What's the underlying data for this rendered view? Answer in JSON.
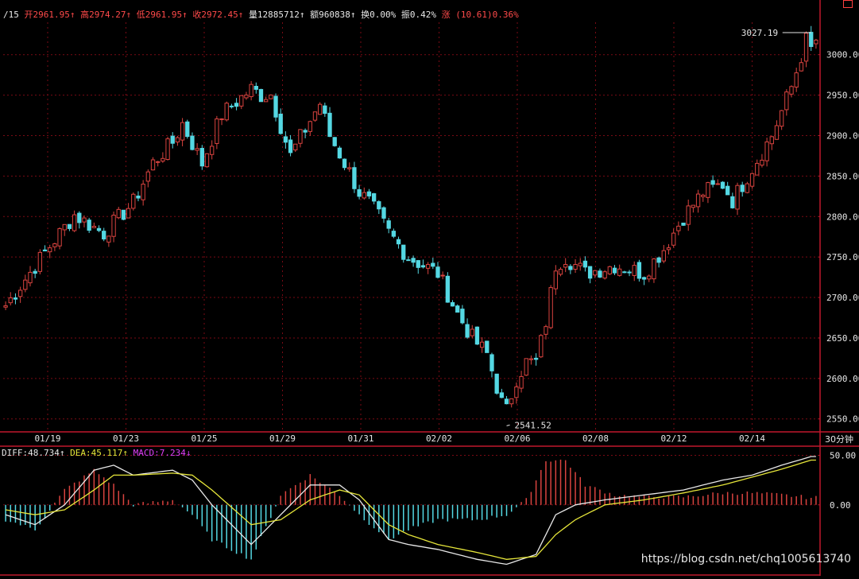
{
  "colors": {
    "up": "#d9433f",
    "down": "#54d8e3",
    "border": "#c0182c",
    "grid": "#7a0a14",
    "axis_text": "#e6e6e6",
    "diff": "#e8e8e8",
    "dea": "#e6e63a",
    "macd": "#e040fb",
    "header_red": "#ff4a4a"
  },
  "header": {
    "prefix": "/15",
    "open": "开2961.95↑",
    "high": "高2974.27↑",
    "low": "低2961.95↑",
    "close": "收2972.45↑",
    "volume": "量12885712↑",
    "amount": "额960838↑",
    "turnover": "换0.00%",
    "amplitude": "振0.42%",
    "change_label": "涨",
    "change_value": "(10.61)0.36%"
  },
  "macd_header": {
    "diff": "DIFF:48.734↑",
    "dea": "DEA:45.117↑",
    "macd": "MACD:7.234↓"
  },
  "period_label": "30分钟",
  "watermark": "https://blog.csdn.net/chq1005613740",
  "chart_data": [
    {
      "type": "candlestick",
      "title": "",
      "x_ticks": [
        "01/19",
        "01/23",
        "01/25",
        "01/29",
        "01/31",
        "02/02",
        "02/06",
        "02/08",
        "02/12",
        "02/14"
      ],
      "y_ticks": [
        "3000.00",
        "2950.00",
        "2900.00",
        "2850.00",
        "2800.00",
        "2750.00",
        "2700.00",
        "2650.00",
        "2600.00",
        "2550.00"
      ],
      "ylim": [
        2535,
        3040
      ],
      "annotations": [
        {
          "text": "3027.19",
          "value": 3027.19,
          "candle_index": 164
        },
        {
          "text": "2541.52",
          "value": 2541.52,
          "candle_index": 102
        }
      ],
      "close_path_anchors": [
        [
          0,
          2690
        ],
        [
          8,
          2760
        ],
        [
          14,
          2810
        ],
        [
          20,
          2790
        ],
        [
          26,
          2830
        ],
        [
          30,
          2880
        ],
        [
          36,
          2920
        ],
        [
          40,
          2870
        ],
        [
          44,
          2930
        ],
        [
          50,
          2960
        ],
        [
          54,
          2960
        ],
        [
          56,
          2920
        ],
        [
          58,
          2880
        ],
        [
          60,
          2900
        ],
        [
          64,
          2940
        ],
        [
          68,
          2890
        ],
        [
          70,
          2860
        ],
        [
          74,
          2810
        ],
        [
          78,
          2770
        ],
        [
          82,
          2740
        ],
        [
          88,
          2720
        ],
        [
          92,
          2670
        ],
        [
          95,
          2640
        ],
        [
          98,
          2620
        ],
        [
          101,
          2560
        ],
        [
          102,
          2550
        ],
        [
          104,
          2590
        ],
        [
          106,
          2610
        ],
        [
          108,
          2610
        ],
        [
          110,
          2660
        ],
        [
          112,
          2730
        ],
        [
          114,
          2740
        ],
        [
          118,
          2720
        ],
        [
          124,
          2730
        ],
        [
          130,
          2720
        ],
        [
          134,
          2750
        ],
        [
          138,
          2790
        ],
        [
          142,
          2820
        ],
        [
          146,
          2830
        ],
        [
          148,
          2810
        ],
        [
          152,
          2850
        ],
        [
          156,
          2890
        ],
        [
          160,
          2950
        ],
        [
          164,
          3027
        ]
      ],
      "wave_anchors": [
        [
          0,
          0
        ],
        [
          18,
          -40
        ],
        [
          34,
          -60
        ],
        [
          36,
          -20
        ],
        [
          50,
          -10
        ],
        [
          52,
          -40
        ],
        [
          56,
          -30
        ],
        [
          60,
          -10
        ],
        [
          64,
          0
        ],
        [
          66,
          -60
        ],
        [
          68,
          -50
        ],
        [
          70,
          -20
        ],
        [
          72,
          -20
        ],
        [
          74,
          30
        ],
        [
          76,
          40
        ]
      ]
    },
    {
      "type": "line",
      "title": "",
      "y_ticks": [
        "50.00",
        "0.00"
      ],
      "ylim": [
        -70,
        60
      ],
      "series": [
        {
          "name": "DIFF",
          "anchors": [
            [
              0,
              -10
            ],
            [
              6,
              -20
            ],
            [
              12,
              0
            ],
            [
              18,
              35
            ],
            [
              22,
              40
            ],
            [
              26,
              30
            ],
            [
              34,
              35
            ],
            [
              38,
              25
            ],
            [
              42,
              0
            ],
            [
              50,
              -40
            ],
            [
              56,
              -10
            ],
            [
              62,
              20
            ],
            [
              68,
              20
            ],
            [
              72,
              5
            ],
            [
              78,
              -35
            ],
            [
              82,
              -40
            ],
            [
              88,
              -45
            ],
            [
              96,
              -55
            ],
            [
              102,
              -60
            ],
            [
              108,
              -50
            ],
            [
              112,
              -10
            ],
            [
              116,
              0
            ],
            [
              122,
              5
            ],
            [
              130,
              10
            ],
            [
              138,
              15
            ],
            [
              146,
              25
            ],
            [
              152,
              30
            ],
            [
              158,
              40
            ],
            [
              164,
              48.734
            ]
          ]
        },
        {
          "name": "DEA",
          "anchors": [
            [
              0,
              -5
            ],
            [
              6,
              -10
            ],
            [
              12,
              -5
            ],
            [
              18,
              15
            ],
            [
              22,
              30
            ],
            [
              26,
              30
            ],
            [
              34,
              32
            ],
            [
              38,
              30
            ],
            [
              42,
              15
            ],
            [
              50,
              -20
            ],
            [
              56,
              -15
            ],
            [
              62,
              5
            ],
            [
              68,
              15
            ],
            [
              72,
              10
            ],
            [
              78,
              -20
            ],
            [
              82,
              -30
            ],
            [
              88,
              -40
            ],
            [
              96,
              -48
            ],
            [
              102,
              -55
            ],
            [
              108,
              -52
            ],
            [
              112,
              -30
            ],
            [
              116,
              -15
            ],
            [
              122,
              0
            ],
            [
              130,
              5
            ],
            [
              138,
              12
            ],
            [
              146,
              20
            ],
            [
              152,
              28
            ],
            [
              158,
              36
            ],
            [
              164,
              45.117
            ]
          ]
        },
        {
          "name": "MACD",
          "anchors": [
            [
              0,
              -15
            ],
            [
              6,
              -25
            ],
            [
              12,
              15
            ],
            [
              18,
              35
            ],
            [
              22,
              20
            ],
            [
              26,
              0
            ],
            [
              34,
              5
            ],
            [
              38,
              -10
            ],
            [
              42,
              -35
            ],
            [
              50,
              -55
            ],
            [
              56,
              10
            ],
            [
              62,
              30
            ],
            [
              68,
              10
            ],
            [
              72,
              -10
            ],
            [
              78,
              -35
            ],
            [
              82,
              -25
            ],
            [
              88,
              -15
            ],
            [
              96,
              -15
            ],
            [
              102,
              -10
            ],
            [
              106,
              5
            ],
            [
              110,
              45
            ],
            [
              114,
              45
            ],
            [
              118,
              20
            ],
            [
              124,
              10
            ],
            [
              130,
              8
            ],
            [
              138,
              8
            ],
            [
              146,
              12
            ],
            [
              152,
              12
            ],
            [
              158,
              10
            ],
            [
              164,
              7.234
            ]
          ]
        }
      ]
    }
  ]
}
